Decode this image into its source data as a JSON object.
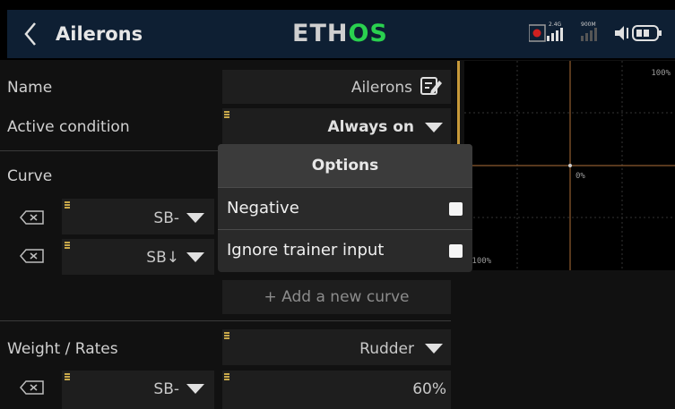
{
  "header": {
    "back_label": "<",
    "title": "Ailerons",
    "logo_main": "ETH",
    "logo_accent": "OS",
    "rf_band": "2.4G",
    "rf_band2": "900M"
  },
  "form": {
    "name_label": "Name",
    "name_value": "Ailerons",
    "active_condition_label": "Active condition",
    "active_condition_value": "Always on",
    "curve_label": "Curve",
    "curve_rows": [
      {
        "source": "SB-"
      },
      {
        "source": "SB↓"
      }
    ],
    "add_curve_label": "+ Add a new curve",
    "weight_label": "Weight / Rates",
    "weight_source": "Rudder",
    "weight_row_source": "SB-",
    "weight_row_value": "60%"
  },
  "graph": {
    "top_label": "100%",
    "center_label": "0%",
    "bottom_label": "-100%"
  },
  "options_popup": {
    "title": "Options",
    "items": [
      {
        "label": "Negative",
        "checked": false
      },
      {
        "label": "Ignore trainer input",
        "checked": false
      }
    ]
  },
  "colors": {
    "accent": "#2ad14f",
    "grip": "#c8a84a",
    "header_bg": "#0e1f33",
    "graph_axis": "#b0703a"
  }
}
